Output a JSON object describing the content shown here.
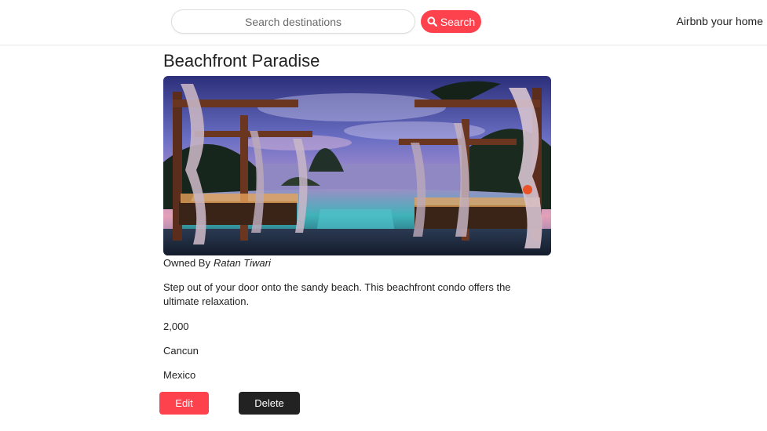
{
  "navbar": {
    "search_placeholder": "Search destinations",
    "search_button_label": "Search",
    "search_icon": "search-icon",
    "host_link_label": "Airbnb your home"
  },
  "listing": {
    "title": "Beachfront Paradise",
    "image_description": "Resort cabanas beside infinity pool at sunset",
    "owner_prefix": "Owned By",
    "owner_name": "Ratan Tiwari",
    "description": "Step out of your door onto the sandy beach. This beachfront condo offers the ultimate relaxation.",
    "price": "2,000",
    "location": "Cancun",
    "country": "Mexico"
  },
  "actions": {
    "edit_label": "Edit",
    "delete_label": "Delete"
  },
  "colors": {
    "accent": "#fe424d",
    "dark_button": "#222222",
    "text": "#222222"
  }
}
